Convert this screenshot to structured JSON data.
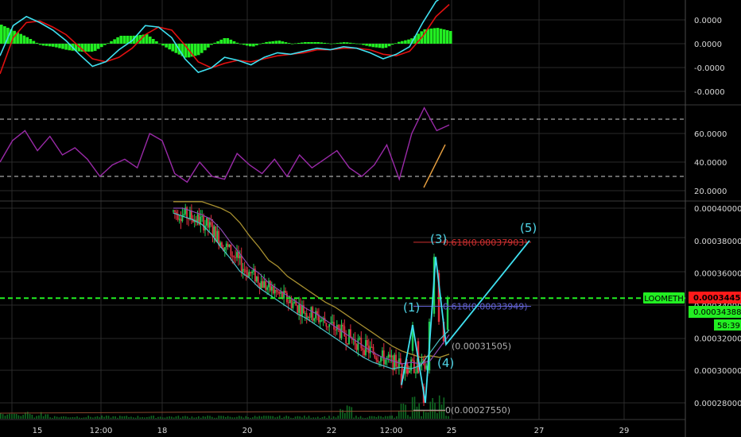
{
  "colors": {
    "background": "#000000",
    "grid": "#2a2a2a",
    "macd_line": "#3fe0f0",
    "signal_line": "#e01010",
    "histogram": "#22ee22",
    "rsi_line": "#9a2aa8",
    "rsi_level": "#cfcfcf",
    "rsi_trend": "#e8a040",
    "candle_up": "#22cc55",
    "candle_down": "#e03040",
    "ma_fast": "#4cc0c8",
    "ma_mid": "#8a4ab0",
    "ma_slow": "#a89030",
    "wave": "#3fe0f0",
    "fib_618_upper": "#d03030",
    "fib_618_lower": "#6060d0",
    "fib_level_grey": "#b0b0b0",
    "price_line": "#22ee22",
    "symbol_tag": "#22ee22",
    "price_tag": "#ff1a1a",
    "volume": "#0f6a22"
  },
  "symbol_tag": "LOOMETH",
  "current_price_tag": "0.00034453",
  "last_price_tag": "0.00034388",
  "countdown_tag": "58:39",
  "time_labels": [
    "15",
    "12:00",
    "18",
    "20",
    "22",
    "12:00",
    "25",
    "27",
    "29"
  ],
  "chart_data": [
    {
      "type": "line",
      "panel": "macd",
      "yticks": [
        "0.0000",
        "0.0000",
        "-0.0000",
        "-0.0000"
      ],
      "series": [
        {
          "values": [
            -0.4,
            0.6,
            0.9,
            0.7,
            0.45,
            0.1,
            -0.35,
            -0.75,
            -0.6,
            -0.2,
            0.1,
            0.6,
            0.55,
            0.2,
            -0.5,
            -0.95,
            -0.8,
            -0.45,
            -0.55,
            -0.7,
            -0.45,
            -0.3,
            -0.35,
            -0.25,
            -0.15,
            -0.2,
            -0.1,
            -0.15,
            -0.3,
            -0.5,
            -0.35,
            -0.1,
            0.7,
            1.4,
            1.7
          ]
        },
        {
          "values": [
            -1.0,
            0.2,
            0.7,
            0.75,
            0.55,
            0.3,
            -0.1,
            -0.5,
            -0.6,
            -0.45,
            -0.15,
            0.3,
            0.55,
            0.45,
            -0.05,
            -0.6,
            -0.8,
            -0.65,
            -0.55,
            -0.6,
            -0.5,
            -0.4,
            -0.35,
            -0.3,
            -0.2,
            -0.2,
            -0.15,
            -0.15,
            -0.2,
            -0.35,
            -0.4,
            -0.25,
            0.25,
            0.9,
            1.3
          ]
        }
      ]
    },
    {
      "type": "line",
      "panel": "rsi",
      "yticks": [
        "60.0000",
        "40.0000",
        "20.0000"
      ],
      "levels": [
        70,
        30
      ],
      "ylim": [
        18,
        80
      ],
      "series": [
        {
          "values": [
            40,
            55,
            62,
            48,
            58,
            45,
            50,
            42,
            30,
            38,
            42,
            36,
            60,
            55,
            32,
            26,
            40,
            30,
            28,
            46,
            38,
            32,
            42,
            30,
            45,
            36,
            42,
            48,
            36,
            30,
            38,
            52,
            28,
            60,
            78,
            62,
            66
          ]
        }
      ]
    },
    {
      "type": "line",
      "panel": "price",
      "yticks": [
        "0.00040000",
        "0.00038000",
        "0.00036000",
        "0.00034000",
        "0.00032000",
        "0.00030000",
        "0.00028000"
      ],
      "ylim": [
        0.000275,
        0.000401
      ],
      "series": [
        {
          "values": [
            0.000398,
            0.000396,
            0.000394,
            0.000391,
            0.000385,
            0.000377,
            0.00037,
            0.000362,
            0.000358,
            0.000352,
            0.000348,
            0.000344,
            0.00034,
            0.000336,
            0.000333,
            0.000329,
            0.000325,
            0.000321,
            0.000317,
            0.000313,
            0.000309,
            0.000306,
            0.000304,
            0.000302,
            0.000303,
            0.000302,
            0.000304,
            0.000312,
            0.00032,
            0.000326
          ]
        }
      ],
      "waves": {
        "labels": [
          "(1)",
          "(3)",
          "(4)",
          "(5)"
        ],
        "points": [
          {
            "x": 505,
            "y": 0.000291
          },
          {
            "x": 519,
            "y": 0.000328
          },
          {
            "x": 535,
            "y": 0.00028
          },
          {
            "x": 548,
            "y": 0.00037
          },
          {
            "x": 561,
            "y": 0.000316
          },
          {
            "x": 666,
            "y": 0.00038
          }
        ]
      },
      "fib_levels": [
        {
          "label": "0.618(0.00037903)",
          "value": 0.00037903
        },
        {
          "label": "0.618(0.00033949)",
          "value": 0.00033949
        },
        {
          "label": "(0.00031505)",
          "value": 0.00031505
        },
        {
          "label": "0(0.00027550)",
          "value": 0.0002755
        }
      ],
      "current_price": 0.00034453
    }
  ]
}
